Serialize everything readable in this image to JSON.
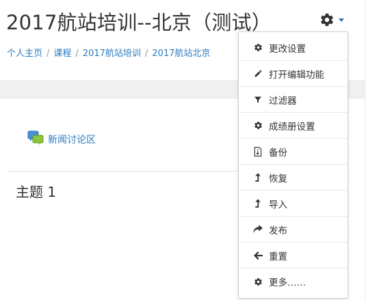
{
  "page": {
    "title": "2017航站培训--北京（测试）"
  },
  "breadcrumb": [
    "个人主页",
    "课程",
    "2017航站培训",
    "2017航站北京"
  ],
  "breadcrumb_separator": "/",
  "forum": {
    "label": "新闻讨论区"
  },
  "section": {
    "title": "主题 1"
  },
  "menu": {
    "items": [
      {
        "label": "更改设置",
        "icon": "gear-icon"
      },
      {
        "label": "打开编辑功能",
        "icon": "pencil-icon"
      },
      {
        "label": "过滤器",
        "icon": "filter-icon"
      },
      {
        "label": "成绩册设置",
        "icon": "gear-icon"
      },
      {
        "label": "备份",
        "icon": "file-zip-icon"
      },
      {
        "label": "恢复",
        "icon": "level-up-icon"
      },
      {
        "label": "导入",
        "icon": "level-up-icon"
      },
      {
        "label": "发布",
        "icon": "share-icon"
      },
      {
        "label": "重置",
        "icon": "arrow-left-icon"
      },
      {
        "label": "更多……",
        "icon": "gear-icon"
      }
    ]
  },
  "colors": {
    "link": "#2a7abf",
    "text": "#333333",
    "band": "#f0f0f0"
  }
}
